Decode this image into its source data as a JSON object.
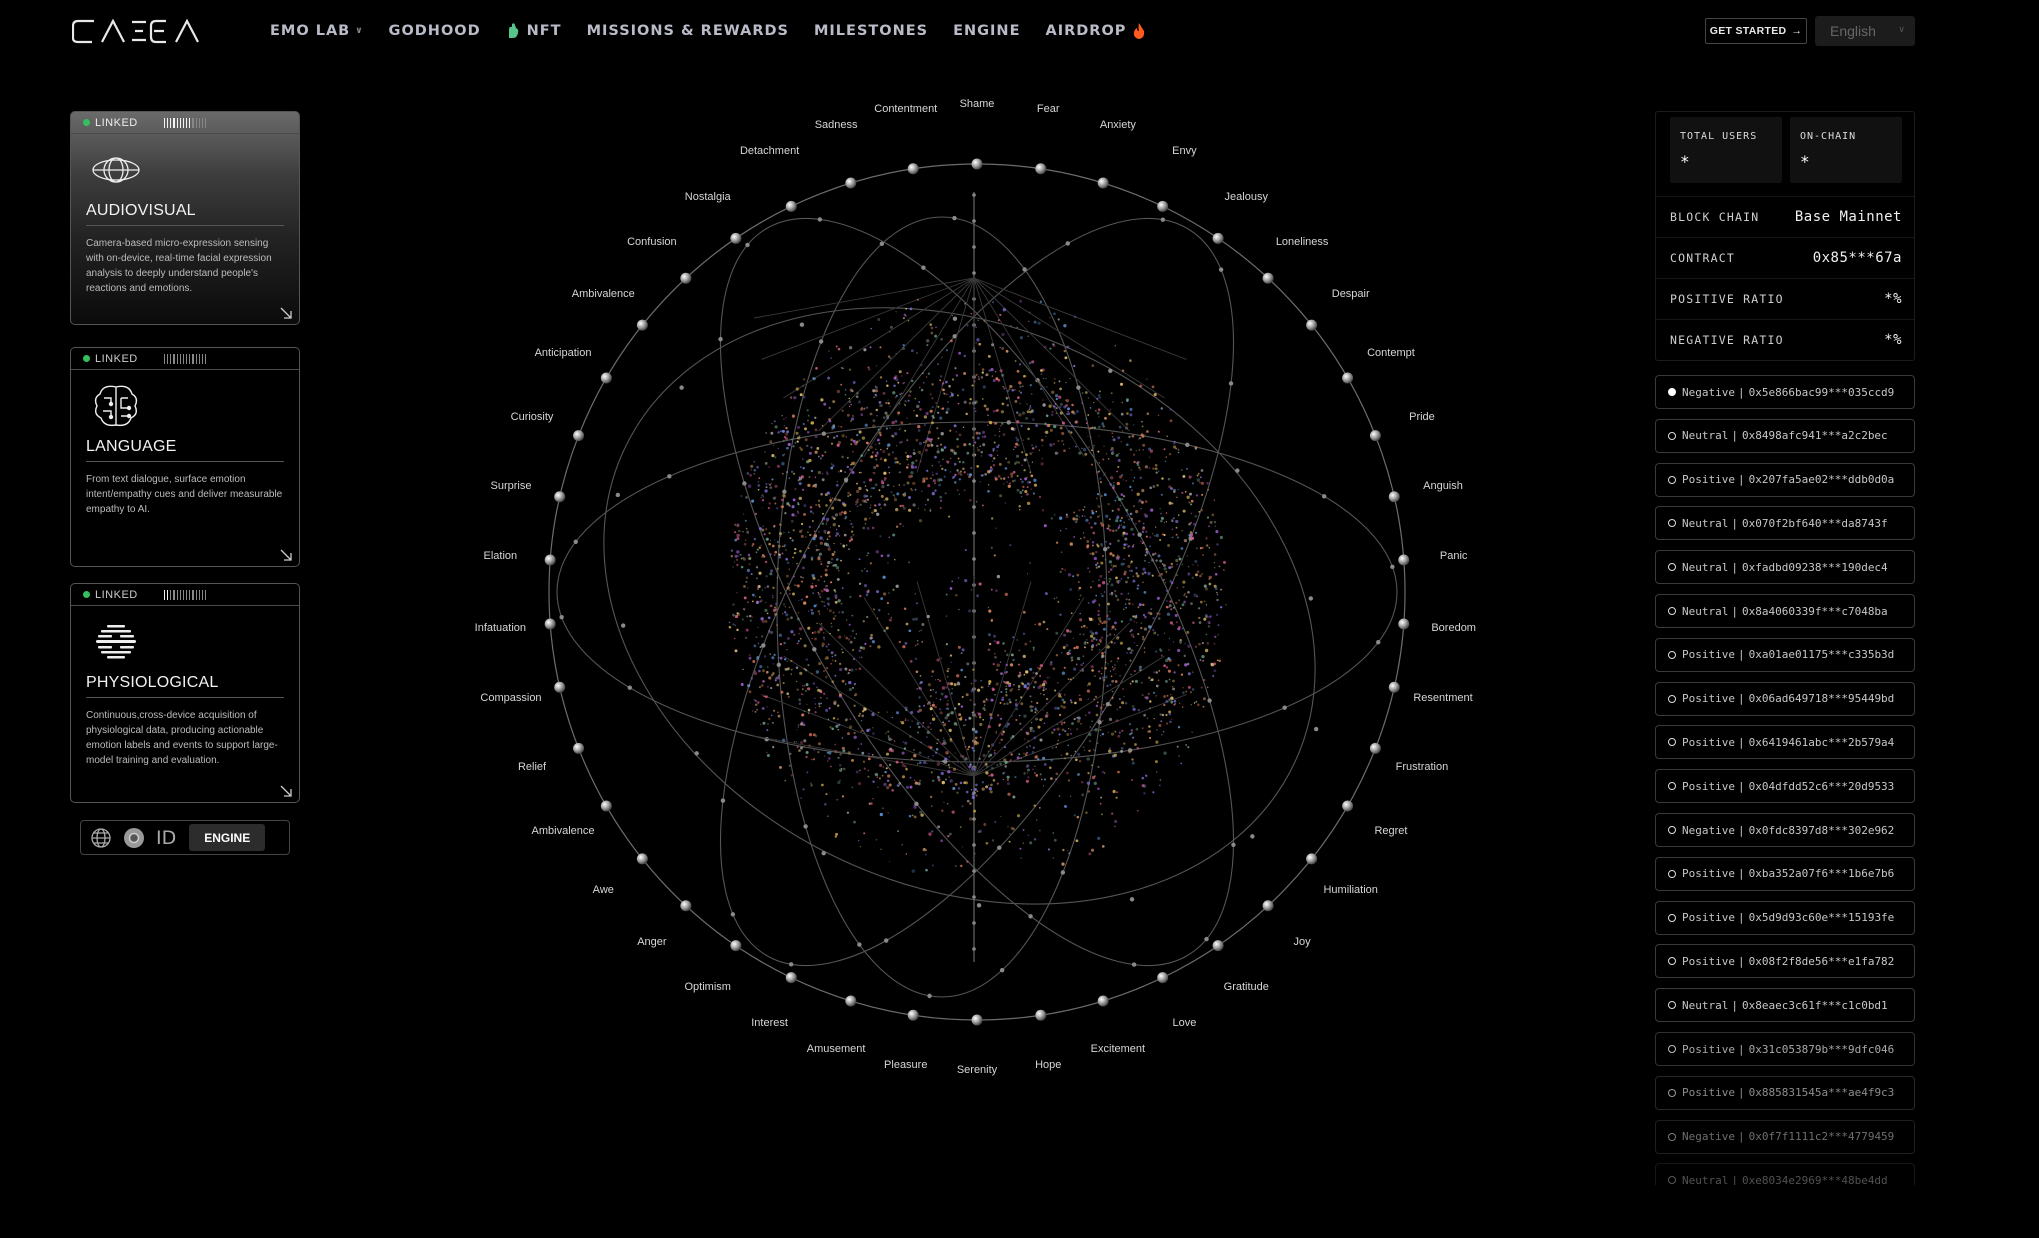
{
  "nav": {
    "brand": "GAIEA",
    "links": [
      {
        "label": "EMO LAB",
        "has_dropdown": true
      },
      {
        "label": "GODHOOD"
      },
      {
        "label": "NFT",
        "icon": "hand-icon"
      },
      {
        "label": "MISSIONS & REWARDS"
      },
      {
        "label": "MILESTONES"
      },
      {
        "label": "ENGINE"
      },
      {
        "label": "AIRDROP",
        "icon": "fire-icon"
      }
    ],
    "get_started": "GET STARTED",
    "language": "English"
  },
  "cards": [
    {
      "status": "LINKED",
      "title": "AUDIOVISUAL",
      "desc": "Camera-based micro-expression sensing with on-device, real-time facial expression analysis to deeply understand people's reactions and emotions.",
      "icon": "eye-orbit-icon"
    },
    {
      "status": "LINKED",
      "title": "LANGUAGE",
      "desc": "From text dialogue, surface emotion intent/empathy cues and deliver measurable empathy to AI.",
      "icon": "brain-icon"
    },
    {
      "status": "LINKED",
      "title": "PHYSIOLOGICAL",
      "desc": "Continuous,cross-device acquisition of physiological data, producing actionable emotion labels and events to support large-model training and evaluation.",
      "icon": "wave-sphere-icon"
    }
  ],
  "engine_bar": {
    "id_label": "ID",
    "engine_label": "ENGINE"
  },
  "emotions": [
    "Shame",
    "Fear",
    "Anxiety",
    "Envy",
    "Jealousy",
    "Loneliness",
    "Despair",
    "Contempt",
    "Pride",
    "Anguish",
    "Panic",
    "Boredom",
    "Resentment",
    "Frustration",
    "Regret",
    "Humiliation",
    "Joy",
    "Gratitude",
    "Love",
    "Excitement",
    "Hope",
    "Serenity",
    "Pleasure",
    "Amusement",
    "Interest",
    "Optimism",
    "Anger",
    "Awe",
    "Ambivalence",
    "Relief",
    "Compassion",
    "Infatuation",
    "Elation",
    "Surprise",
    "Curiosity",
    "Anticipation",
    "Ambivalence",
    "Confusion",
    "Nostalgia",
    "Detachment",
    "Sadness",
    "Contentment"
  ],
  "stats": {
    "total_users_label": "TOTAL USERS",
    "total_users": "*",
    "onchain_label": "ON-CHAIN",
    "onchain": "*",
    "blockchain_label": "BLOCK CHAIN",
    "blockchain": "Base Mainnet",
    "contract_label": "CONTRACT",
    "contract": "0x85***67a",
    "positive_label": "POSITIVE RATIO",
    "positive": "*%",
    "negative_label": "NEGATIVE RATIO",
    "negative": "*%"
  },
  "feed": [
    {
      "sentiment": "Negative",
      "address": "0x5e866bac99***035ccd9",
      "active": true
    },
    {
      "sentiment": "Neutral",
      "address": "0x8498afc941***a2c2bec"
    },
    {
      "sentiment": "Positive",
      "address": "0x207fa5ae02***ddb0d0a"
    },
    {
      "sentiment": "Neutral",
      "address": "0x070f2bf640***da8743f"
    },
    {
      "sentiment": "Neutral",
      "address": "0xfadbd09238***190dec4"
    },
    {
      "sentiment": "Neutral",
      "address": "0x8a4060339f***c7048ba"
    },
    {
      "sentiment": "Positive",
      "address": "0xa01ae01175***c335b3d"
    },
    {
      "sentiment": "Positive",
      "address": "0x06ad649718***95449bd"
    },
    {
      "sentiment": "Positive",
      "address": "0x6419461abc***2b579a4"
    },
    {
      "sentiment": "Positive",
      "address": "0x04dfdd52c6***20d9533"
    },
    {
      "sentiment": "Negative",
      "address": "0x0fdc8397d8***302e962"
    },
    {
      "sentiment": "Positive",
      "address": "0xba352a07f6***1b6e7b6"
    },
    {
      "sentiment": "Positive",
      "address": "0x5d9d93c60e***15193fe"
    },
    {
      "sentiment": "Positive",
      "address": "0x08f2f8de56***e1fa782"
    },
    {
      "sentiment": "Neutral",
      "address": "0x8eaec3c61f***c1c0bd1"
    },
    {
      "sentiment": "Positive",
      "address": "0x31c053879b***9dfc046"
    },
    {
      "sentiment": "Positive",
      "address": "0x885831545a***ae4f9c3"
    },
    {
      "sentiment": "Negative",
      "address": "0x0f7f1111c2***4779459"
    },
    {
      "sentiment": "Neutral",
      "address": "0xe8034e2969***48be4dd"
    }
  ],
  "colors": {
    "accent_green": "#33c15d",
    "fire": "#ff5a1f"
  }
}
